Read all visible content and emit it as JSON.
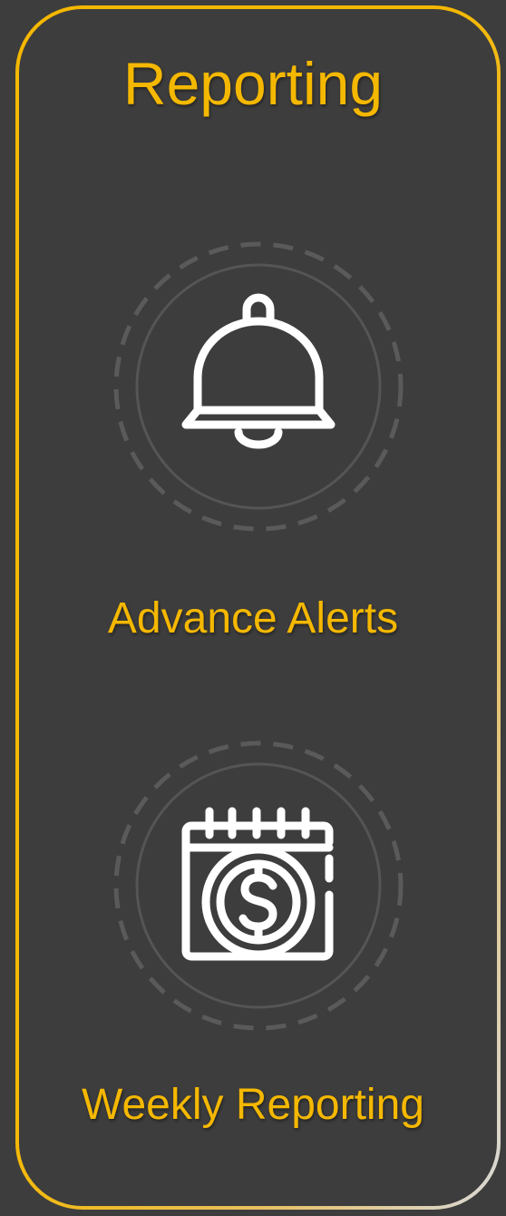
{
  "card": {
    "title": "Reporting",
    "accent_color": "#f5b800",
    "background_color": "#3d3d3d"
  },
  "features": [
    {
      "label": "Advance Alerts",
      "icon": "bell-icon"
    },
    {
      "label": "Weekly Reporting",
      "icon": "calendar-dollar-icon"
    }
  ]
}
